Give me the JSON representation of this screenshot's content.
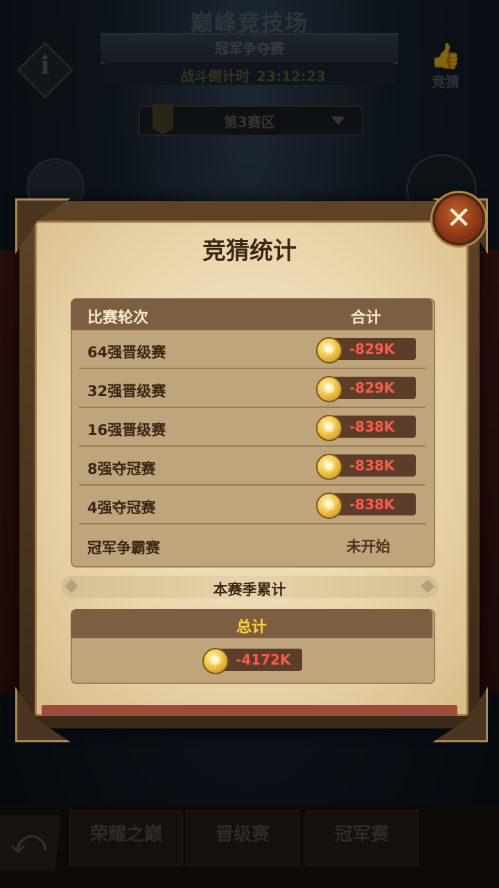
{
  "background": {
    "title": "巅峰竞技场",
    "subtitle": "冠军争夺赛",
    "countdown_label": "战斗倒计时",
    "countdown_value": "23:12:23",
    "guess_label": "竞猜",
    "zone_label": "第3赛区",
    "tabs": [
      "荣耀之巅",
      "晋级赛",
      "冠军赛"
    ]
  },
  "dialog": {
    "title": "竞猜统计",
    "columns": {
      "round": "比赛轮次",
      "total": "合计"
    },
    "rows": [
      {
        "label": "64强晋级赛",
        "value": "-829K"
      },
      {
        "label": "32强晋级赛",
        "value": "-829K"
      },
      {
        "label": "16强晋级赛",
        "value": "-838K"
      },
      {
        "label": "8强夺冠赛",
        "value": "-838K"
      },
      {
        "label": "4强夺冠赛",
        "value": "-838K"
      },
      {
        "label": "冠军争霸赛",
        "status": "未开始"
      }
    ],
    "season_label": "本赛季累计",
    "total_title": "总计",
    "total_value": "-4172K"
  },
  "colors": {
    "negative_value": "#ff5a4a",
    "total_title": "#ffd23a",
    "header_band": "#7c5f40",
    "parchment": "#ead6ac"
  },
  "icons": {
    "close": "close-icon",
    "coin": "gold-coin-icon",
    "info": "info-icon",
    "guess": "thumbs-up-icon",
    "back": "back-arrow-icon"
  }
}
